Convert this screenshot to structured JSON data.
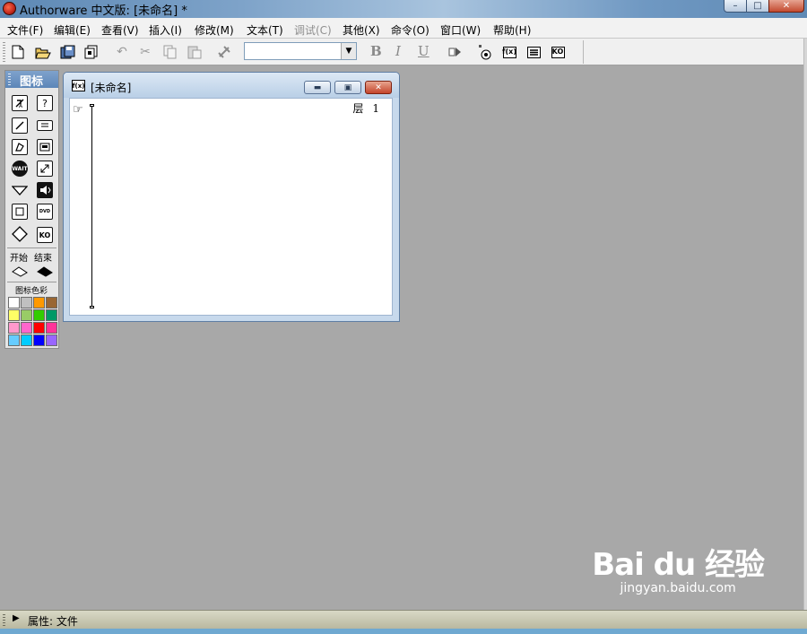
{
  "window": {
    "title": "Authorware 中文版: [未命名] *",
    "buttons": {
      "minimize": "–",
      "maximize": "□",
      "close": "✕"
    }
  },
  "menu": [
    {
      "label": "文件(F)",
      "enabled": true
    },
    {
      "label": "编辑(E)",
      "enabled": true
    },
    {
      "label": "查看(V)",
      "enabled": true
    },
    {
      "label": "插入(I)",
      "enabled": true
    },
    {
      "label": "修改(M)",
      "enabled": true
    },
    {
      "label": "文本(T)",
      "enabled": true
    },
    {
      "label": "调试(C)",
      "enabled": false
    },
    {
      "label": "其他(X)",
      "enabled": true
    },
    {
      "label": "命令(O)",
      "enabled": true
    },
    {
      "label": "窗口(W)",
      "enabled": true
    },
    {
      "label": "帮助(H)",
      "enabled": true
    }
  ],
  "toolbar": {
    "font_select_value": "",
    "bold_label": "B",
    "italic_label": "I",
    "underline_label": "U",
    "functions_box": "f(x)",
    "knowledge_box": "KO"
  },
  "palette": {
    "title": "图标",
    "icons_left": [
      "display-icon",
      "erase-icon",
      "calculation-icon-left",
      "wait-icon",
      "navigate-icon",
      "map-icon",
      "decision-icon"
    ],
    "icons_right": [
      "motion-icon",
      "wait-icon-right",
      "interaction-icon",
      "movie-icon",
      "sound-icon",
      "video-icon",
      "knowledge-object-icon"
    ],
    "wait_label": "WAIT",
    "dvd_label": "DVD",
    "ko_label": "KO",
    "start_label": "开始",
    "end_label": "结束",
    "color_label": "图标色彩",
    "colors": [
      "#ffffff",
      "#c0c0c0",
      "#ff9900",
      "#996633",
      "#ffff66",
      "#99cc66",
      "#33cc00",
      "#009966",
      "#ff99cc",
      "#ff66cc",
      "#ff0000",
      "#ff3399",
      "#66ccff",
      "#00ccff",
      "#0000ff",
      "#9966ff"
    ]
  },
  "design_window": {
    "title": "[未命名]",
    "icon_label": "f(x)",
    "layer_label": "层",
    "layer_number": "1"
  },
  "properties_bar": {
    "label": "属性: 文件"
  },
  "watermark": {
    "logo": "Bai du 经验",
    "url": "jingyan.baidu.com"
  }
}
